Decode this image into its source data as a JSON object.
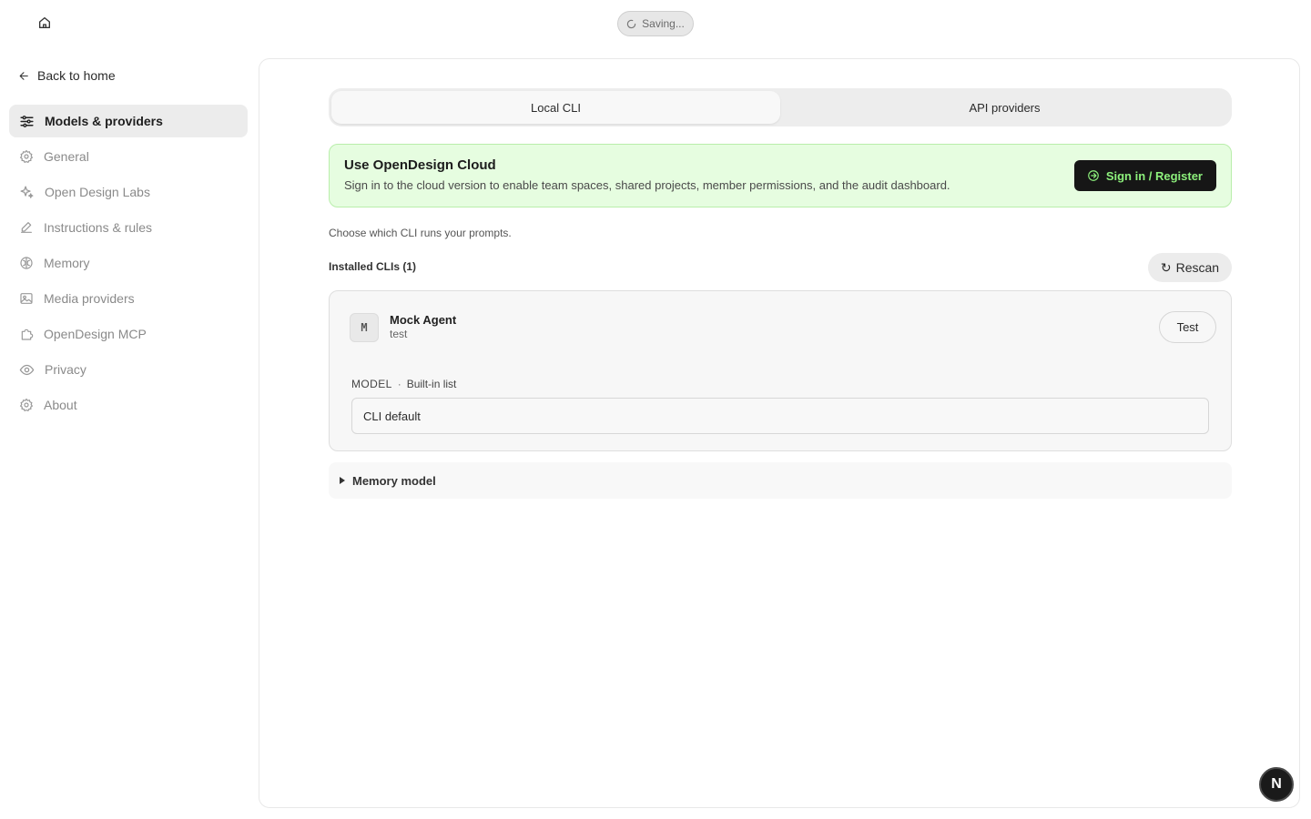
{
  "status": {
    "saving_label": "Saving..."
  },
  "sidebar": {
    "back_label": "Back to home",
    "items": [
      {
        "label": "Models & providers",
        "icon": "sliders-icon",
        "active": true
      },
      {
        "label": "General",
        "icon": "gear-icon"
      },
      {
        "label": "Open Design Labs",
        "icon": "sparkles-icon"
      },
      {
        "label": "Instructions & rules",
        "icon": "pen-icon"
      },
      {
        "label": "Memory",
        "icon": "brain-icon"
      },
      {
        "label": "Media providers",
        "icon": "image-icon"
      },
      {
        "label": "OpenDesign MCP",
        "icon": "plugin-icon"
      },
      {
        "label": "Privacy",
        "icon": "eye-icon"
      },
      {
        "label": "About",
        "icon": "gear-icon"
      }
    ]
  },
  "main": {
    "tabs": [
      {
        "label": "Local CLI",
        "active": true
      },
      {
        "label": "API providers",
        "active": false
      }
    ],
    "cloud": {
      "title": "Use OpenDesign Cloud",
      "description": "Sign in to the cloud version to enable team spaces, shared projects, member permissions, and the audit dashboard.",
      "button_label": "Sign in / Register"
    },
    "choose_text": "Choose which CLI runs your prompts.",
    "installed_title": "Installed CLIs (1)",
    "rescan_label": "Rescan",
    "agent": {
      "avatar_letter": "M",
      "name": "Mock Agent",
      "subtitle": "test",
      "test_label": "Test",
      "model_label": "MODEL",
      "model_separator": "·",
      "model_source": "Built-in list",
      "model_value": "CLI default"
    },
    "memory_model_label": "Memory model"
  },
  "badge": {
    "letter": "N"
  },
  "colors": {
    "banner_bg": "#e6fde0",
    "banner_border": "#b9eeab",
    "signin_bg": "#161616",
    "signin_text": "#8df07c",
    "active_item_bg": "#ececec"
  }
}
